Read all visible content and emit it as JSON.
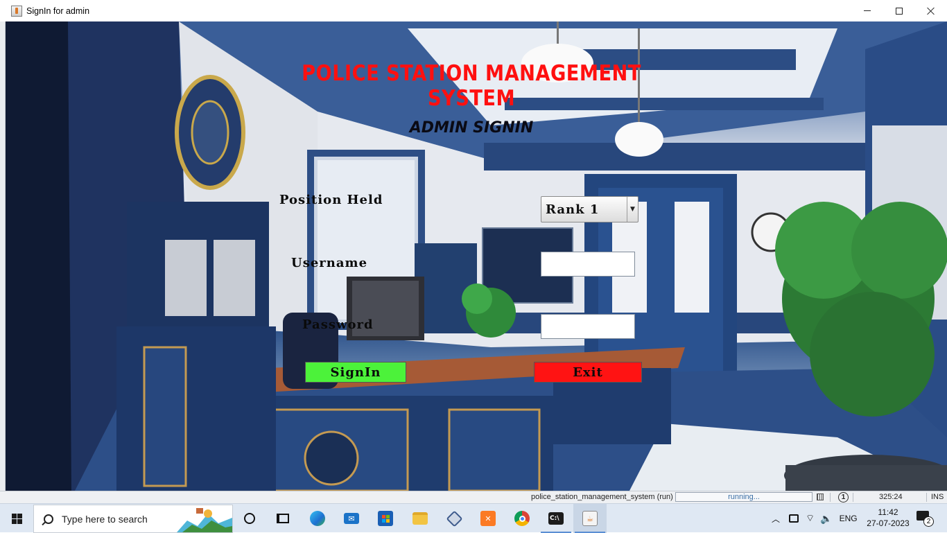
{
  "window": {
    "title": "SignIn for admin"
  },
  "form": {
    "headline": "POLICE STATION MANAGEMENT SYSTEM",
    "subheading": "ADMIN SIGNIN",
    "position_label": "Position Held",
    "position_selected": "Rank 1",
    "username_label": "Username",
    "username_value": "",
    "password_label": "Password",
    "password_value": "",
    "signin_label": "SignIn",
    "exit_label": "Exit"
  },
  "colors": {
    "headline": "#ff1010",
    "signin_button": "#4cf23a",
    "exit_button": "#ff1313"
  },
  "statusbar": {
    "project": "police_station_management_system (run)",
    "progress_text": "running...",
    "notifications": "1",
    "caret_position": "325:24",
    "insert_mode": "INS"
  },
  "taskbar": {
    "search_placeholder": "Type here to search",
    "pinned": [
      "cortana-icon",
      "task-view-icon",
      "edge-icon",
      "mail-icon",
      "store-icon",
      "file-explorer-icon",
      "virtualbox-icon",
      "xampp-icon",
      "chrome-icon",
      "terminal-icon",
      "java-icon"
    ],
    "language": "ENG",
    "time": "11:42",
    "date": "27-07-2023",
    "notification_count": "2"
  }
}
